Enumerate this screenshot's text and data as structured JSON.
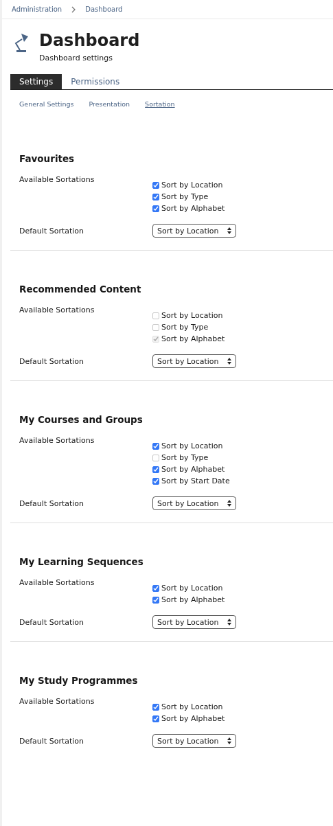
{
  "breadcrumbs": [
    "Administration",
    "Dashboard"
  ],
  "header": {
    "title": "Dashboard",
    "subtitle": "Dashboard settings"
  },
  "tabs": [
    {
      "label": "Settings",
      "selected": true
    },
    {
      "label": "Permissions",
      "selected": false
    }
  ],
  "subtabs": [
    {
      "label": "General Settings",
      "selected": false
    },
    {
      "label": "Presentation",
      "selected": false
    },
    {
      "label": "Sortation",
      "selected": true
    }
  ],
  "sections": [
    {
      "title": "Favourites",
      "available_label": "Available Sortations",
      "options": [
        {
          "label": "Sort by Location",
          "checked": true,
          "disabled": false
        },
        {
          "label": "Sort by Type",
          "checked": true,
          "disabled": false
        },
        {
          "label": "Sort by Alphabet",
          "checked": true,
          "disabled": false
        }
      ],
      "default_label": "Default Sortation",
      "default_value": "Sort by Location"
    },
    {
      "title": "Recommended Content",
      "available_label": "Available Sortations",
      "options": [
        {
          "label": "Sort by Location",
          "checked": false,
          "disabled": false
        },
        {
          "label": "Sort by Type",
          "checked": false,
          "disabled": false
        },
        {
          "label": "Sort by Alphabet",
          "checked": true,
          "disabled": true
        }
      ],
      "default_label": "Default Sortation",
      "default_value": "Sort by Location"
    },
    {
      "title": "My Courses and Groups",
      "available_label": "Available Sortations",
      "options": [
        {
          "label": "Sort by Location",
          "checked": true,
          "disabled": false
        },
        {
          "label": "Sort by Type",
          "checked": false,
          "disabled": false
        },
        {
          "label": "Sort by Alphabet",
          "checked": true,
          "disabled": false
        },
        {
          "label": "Sort by Start Date",
          "checked": true,
          "disabled": false
        }
      ],
      "default_label": "Default Sortation",
      "default_value": "Sort by Location"
    },
    {
      "title": "My Learning Sequences",
      "available_label": "Available Sortations",
      "options": [
        {
          "label": "Sort by Location",
          "checked": true,
          "disabled": false
        },
        {
          "label": "Sort by Alphabet",
          "checked": true,
          "disabled": false
        }
      ],
      "default_label": "Default Sortation",
      "default_value": "Sort by Location"
    },
    {
      "title": "My Study Programmes",
      "available_label": "Available Sortations",
      "options": [
        {
          "label": "Sort by Location",
          "checked": true,
          "disabled": false
        },
        {
          "label": "Sort by Alphabet",
          "checked": true,
          "disabled": false
        }
      ],
      "default_label": "Default Sortation",
      "default_value": "Sort by Location"
    }
  ]
}
